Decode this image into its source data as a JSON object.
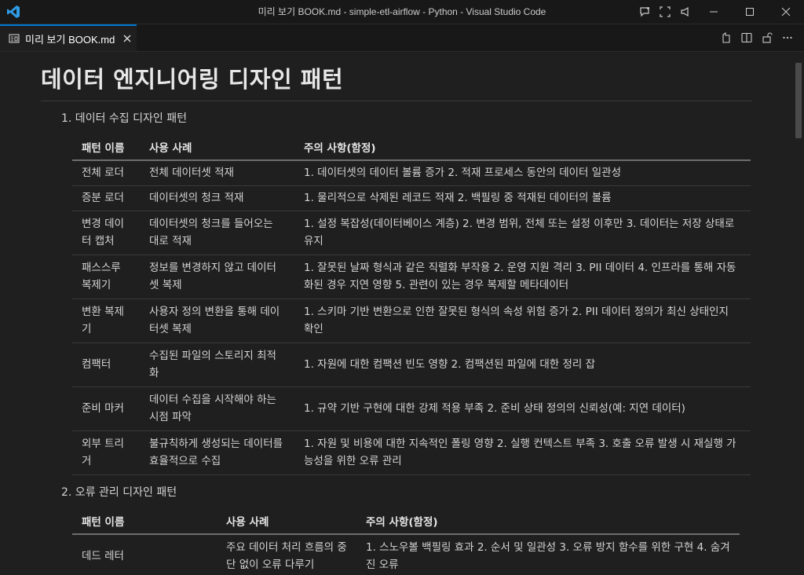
{
  "window": {
    "title": "미리 보기 BOOK.md - simple-etl-airflow - Python - Visual Studio Code"
  },
  "tab": {
    "label": "미리 보기 BOOK.md"
  },
  "document": {
    "title": "데이터 엔지니어링 디자인 패턴",
    "sections": [
      {
        "heading": "1. 데이터 수집 디자인 패턴",
        "columns": [
          "패턴 이름",
          "사용 사례",
          "주의 사항(함정)"
        ],
        "rows": [
          [
            "전체 로더",
            "전체 데이터셋 적재",
            "1. 데이터셋의 데이터 볼륨 증가 2. 적재 프로세스 동안의 데이터 일관성"
          ],
          [
            "증분 로더",
            "데이터셋의 청크 적재",
            "1. 물리적으로 삭제된 레코드 적재 2. 백필링 중 적재된 데이터의 볼륨"
          ],
          [
            "변경 데이터 캡처",
            "데이터셋의 청크를 들어오는 대로 적재",
            "1. 설정 복잡성(데이터베이스 계층) 2. 변경 범위, 전체 또는 설정 이후만 3. 데이터는 저장 상태로 유지"
          ],
          [
            "패스스루 복제기",
            "정보를 변경하지 않고 데이터셋 복제",
            "1. 잘못된 날짜 형식과 같은 직렬화 부작용 2. 운영 지원 격리 3. PII 데이터 4. 인프라를 통해 자동화된 경우 지연 영향 5. 관련이 있는 경우 복제할 메타데이터"
          ],
          [
            "변환 복제기",
            "사용자 정의 변환을 통해 데이터셋 복제",
            "1. 스키마 기반 변환으로 인한 잘못된 형식의 속성 위험 증가 2. PII 데이터 정의가 최신 상태인지 확인"
          ],
          [
            "컴팩터",
            "수집된 파일의 스토리지 최적화",
            "1. 자원에 대한 컴팩션 빈도 영향 2. 컴팩션된 파일에 대한 정리 잡"
          ],
          [
            "준비 마커",
            "데이터 수집을 시작해야 하는 시점 파악",
            "1. 규약 기반 구현에 대한 강제 적용 부족 2. 준비 상태 정의의 신뢰성(예: 지연 데이터)"
          ],
          [
            "외부 트리거",
            "불규칙하게 생성되는 데이터를 효율적으로 수집",
            "1. 자원 및 비용에 대한 지속적인 폴링 영향 2. 실행 컨텍스트 부족 3. 호출 오류 발생 시 재실행 가능성을 위한 오류 관리"
          ]
        ]
      },
      {
        "heading": "2. 오류 관리 디자인 패턴",
        "columns": [
          "패턴 이름",
          "사용 사례",
          "주의 사항(함정)"
        ],
        "rows": [
          [
            "데드 레터",
            "주요 데이터 처리 흐름의 중단 없이 오류 다루기",
            "1. 스노우볼 백필링 효과 2. 순서 및 일관성 3. 오류 방지 함수를 위한 구현 4. 숨겨진 오류"
          ]
        ]
      }
    ]
  },
  "colors": {
    "accent": "#0078d4",
    "editor_bg": "#1f1f1f",
    "titlebar_bg": "#181818"
  },
  "icons": [
    "vscode-logo",
    "copilot-icon",
    "layout-icon",
    "broadcast-icon",
    "minimize-icon",
    "maximize-icon",
    "close-icon",
    "preview-icon",
    "open-source-icon",
    "split-editor-icon",
    "lock-icon",
    "more-icon"
  ]
}
